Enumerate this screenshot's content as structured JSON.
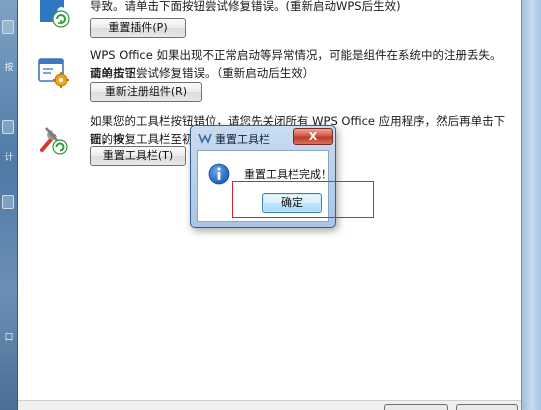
{
  "left_strip": {
    "glyphs": [
      "按",
      "计",
      "口"
    ]
  },
  "sections": [
    {
      "id": "reset-plugin",
      "lines": [
        "导致。请单击下面按钮尝试修复错误。(重新启动WPS后生效)"
      ],
      "button_label": "重置插件(P)",
      "icon": "puzzle-refresh-icon"
    },
    {
      "id": "reregister",
      "lines": [
        "WPS Office 如果出现不正常启动等异常情况，可能是组件在系统中的注册丢失。请单击下",
        "面的按钮尝试修复错误。（重新启动后生效）"
      ],
      "button_label": "重新注册组件(R)",
      "icon": "window-gear-icon"
    },
    {
      "id": "reset-toolbar",
      "lines": [
        "如果您的工具栏按钮错位，请您先关闭所有 WPS Office 应用程序，然后再单击下面的按",
        "钮，恢复工具栏至初始"
      ],
      "button_label": "重置工具栏(T)",
      "icon": "tools-refresh-icon"
    }
  ],
  "dialog": {
    "title": "重置工具栏",
    "close_label": "X",
    "message": "重置工具栏完成！",
    "ok_label": "确定",
    "info_icon": "info-icon",
    "title_icon": "wps-app-icon"
  },
  "colors": {
    "highlight": "#d6262b",
    "dialog_frame": "#a9c5e6",
    "close_button": "#c0392b",
    "info_icon": "#1d5fb6"
  }
}
